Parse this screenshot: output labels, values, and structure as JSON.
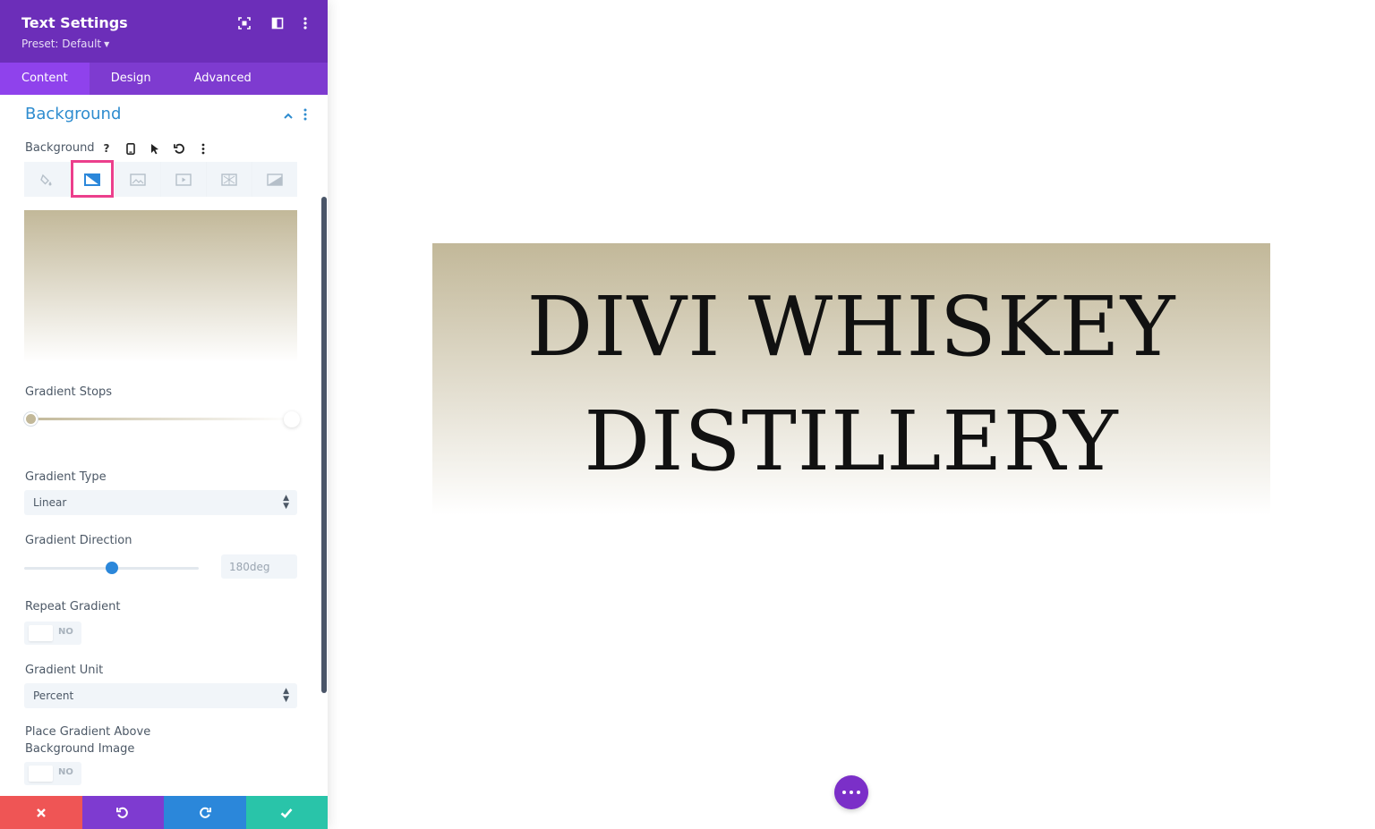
{
  "panel": {
    "title": "Text Settings",
    "preset": "Preset: Default",
    "tabs": [
      {
        "label": "Content",
        "active": true
      },
      {
        "label": "Design",
        "active": false
      },
      {
        "label": "Advanced",
        "active": false
      }
    ]
  },
  "section": {
    "title": "Background",
    "field_label": "Background",
    "background_types": [
      "color-icon",
      "gradient-icon",
      "image-icon",
      "video-icon",
      "pattern-icon",
      "mask-icon"
    ],
    "active_type": "gradient-icon"
  },
  "gradient": {
    "stops_label": "Gradient Stops",
    "stops": [
      {
        "color": "#c2b899",
        "position": 0
      },
      {
        "color": "#ffffff",
        "position": 100
      }
    ],
    "type_label": "Gradient Type",
    "type_value": "Linear",
    "direction_label": "Gradient Direction",
    "direction_value": "180deg",
    "direction_fraction": 0.5,
    "repeat_label": "Repeat Gradient",
    "repeat_value": "NO",
    "unit_label": "Gradient Unit",
    "unit_value": "Percent",
    "above_label_line1": "Place Gradient Above",
    "above_label_line2": "Background Image",
    "above_value": "NO"
  },
  "canvas": {
    "heading_line1": "DIVI WHISKEY",
    "heading_line2": "DISTILLERY"
  },
  "colors": {
    "header": "#6c2eb9",
    "tabs_bg": "#7e3bd0",
    "accent_blue": "#2b87da",
    "highlight": "#ec3f8c",
    "gradient_start": "#c2b899",
    "gradient_end": "#ffffff",
    "footer": [
      "#ef5555",
      "#7e3bd0",
      "#2b87da",
      "#29c4a9"
    ]
  }
}
